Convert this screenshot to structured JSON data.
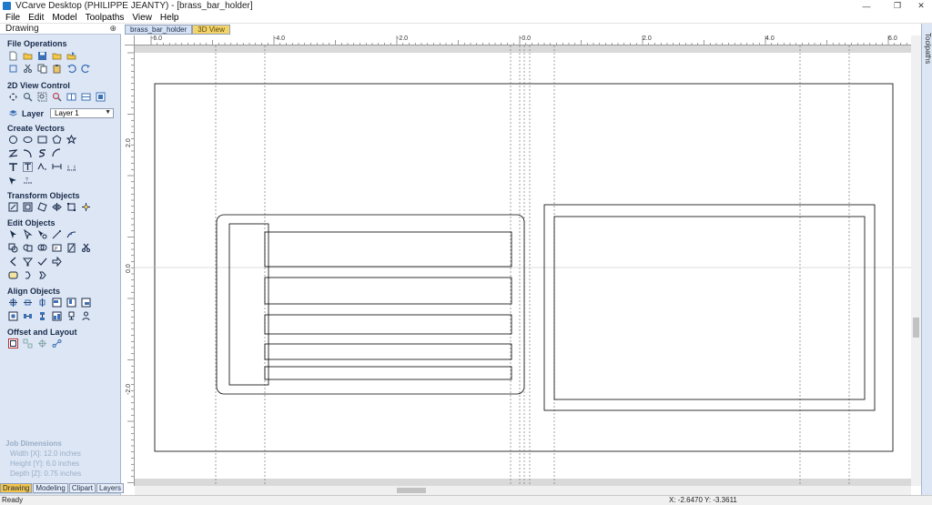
{
  "window": {
    "title": "VCarve Desktop (PHILIPPE JEANTY) - [brass_bar_holder]",
    "min_glyph": "—",
    "restore_glyph": "❐",
    "close_glyph": "✕"
  },
  "menu": [
    "File",
    "Edit",
    "Model",
    "Toolpaths",
    "View",
    "Help"
  ],
  "left_panel": {
    "title": "Drawing",
    "pin_glyph": "⊕",
    "sections": {
      "file_operations": "File Operations",
      "view_control": "2D View Control",
      "create_vectors": "Create Vectors",
      "transform_objects": "Transform Objects",
      "edit_objects": "Edit Objects",
      "align_objects": "Align Objects",
      "offset_layout": "Offset and Layout"
    },
    "layer": {
      "label": "Layer",
      "value": "Layer 1",
      "arrow": "▼"
    },
    "job_dimensions": {
      "heading": "Job Dimensions",
      "width": "Width  [X]: 12.0 inches",
      "height": "Height [Y]: 6.0 inches",
      "depth": "Depth  [Z]: 0.75 inches"
    },
    "tabs": [
      "Drawing",
      "Modeling",
      "Clipart",
      "Layers"
    ]
  },
  "doc_tabs": [
    "brass_bar_holder",
    "3D View"
  ],
  "ruler": {
    "top_labels": [
      "-6.0",
      "-4.0",
      "-2.0",
      "-0.0",
      "2.0",
      "4.0",
      "6.0"
    ],
    "left_labels": [
      "2.0",
      "0.0",
      "-2.0"
    ]
  },
  "right_strip": {
    "label": "Toolpaths"
  },
  "status": {
    "text": "Ready",
    "coords": "X: -2.6470 Y: -3.3611"
  }
}
